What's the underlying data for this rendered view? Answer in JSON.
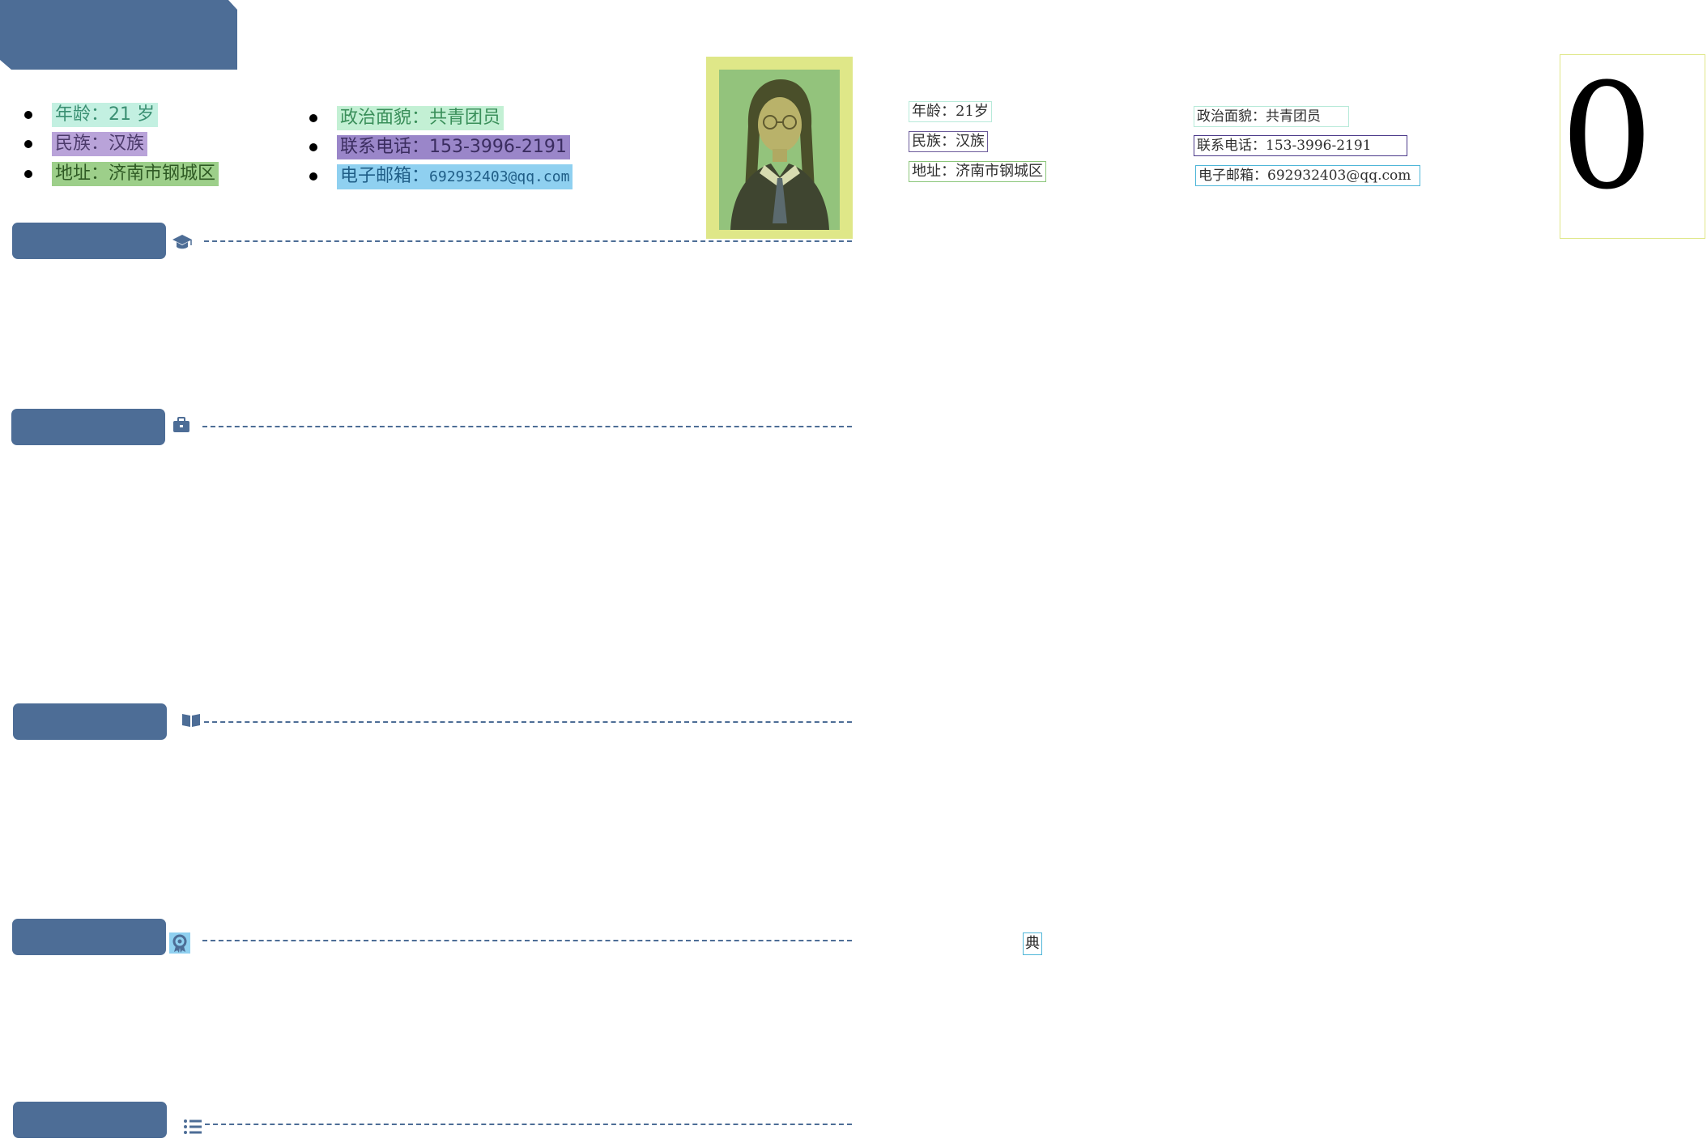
{
  "left_info": {
    "col1": [
      {
        "text": "年龄：21 岁",
        "bg": "#c3f0e1",
        "fg": "#3a8f72"
      },
      {
        "text": "民族：汉族",
        "bg": "#b9a3d9",
        "fg": "#4b3a6a"
      },
      {
        "text": "地址：济南市钢城区",
        "bg": "#9dcf8a",
        "fg": "#2f5a24"
      }
    ],
    "col2": [
      {
        "text": "政治面貌：共青团员",
        "bg": "#c3f0d4",
        "fg": "#3a8f5a"
      },
      {
        "text": "联系电话：153-3996-2191",
        "bg": "#9a86c9",
        "fg": "#3b2d60"
      },
      {
        "label": "电子邮箱：",
        "value": "692932403@qq.com",
        "bg": "#8fd0f0",
        "fg": "#1f5d86"
      }
    ]
  },
  "right_info": {
    "col1": [
      {
        "text": "年龄：21岁",
        "border": "#b7ead9"
      },
      {
        "text": "民族：汉族",
        "border": "#6b5b9a"
      },
      {
        "text": "地址：济南市钢城区",
        "border": "#8bc67a"
      }
    ],
    "col2": [
      {
        "text": "政治面貌：共青团员",
        "border": "#b7ead9"
      },
      {
        "text": "联系电话：153-3996-2191",
        "border": "#4b3a8a"
      },
      {
        "text": "电子邮箱：692932403@qq.com",
        "border": "#4fb6d8"
      }
    ],
    "big_glyph": "0",
    "badge_char": "典"
  },
  "sections": [
    {
      "icon": "graduation-cap-icon"
    },
    {
      "icon": "briefcase-icon"
    },
    {
      "icon": "book-icon"
    },
    {
      "icon": "award-badge-icon"
    },
    {
      "icon": "list-icon"
    }
  ],
  "colors": {
    "accent": "#4d6d96",
    "photo_frame": "#dfe788",
    "photo_bg": "#93c37c"
  }
}
